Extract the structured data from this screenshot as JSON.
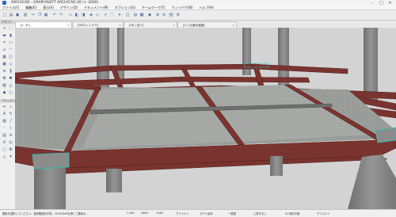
{
  "window": {
    "title": "ARCHICAD - GRAPHISOFT ARCHICAD 26 (+ 3000)"
  },
  "menu": [
    "ファイル(F)",
    "編集(E)",
    "表示(V)",
    "デザイン(D)",
    "ドキュメント(M)",
    "オプション(O)",
    "チームワーク(T)",
    "ウィンドウ(W)",
    "ヘルプ(H)"
  ],
  "tabs": [
    {
      "label": "[1. 1F]"
    },
    {
      "label": "[3Dウィンドウ]"
    },
    {
      "label": "[3D / 全て]"
    },
    {
      "label": "[1.1 生産計画図]"
    }
  ],
  "toolbox": {
    "section1": "デザイン",
    "section2": "ドキュメント"
  },
  "status": {
    "hint": "要素を選択してください、選択範囲を作成、CtrlやShiftを押して要素を...",
    "scale": "1:100",
    "zoom": "100%",
    "angle": "0.00°",
    "pen": "デフォルト",
    "model": "モデル全体",
    "structure": "一般図",
    "renovation": "上書きなし",
    "layer_combo": "01 既存平面",
    "view": "デフォルト"
  },
  "colors": {
    "steel": "#7a3430",
    "concrete": "#8a8a8a",
    "slab": "#a7aaa7"
  }
}
